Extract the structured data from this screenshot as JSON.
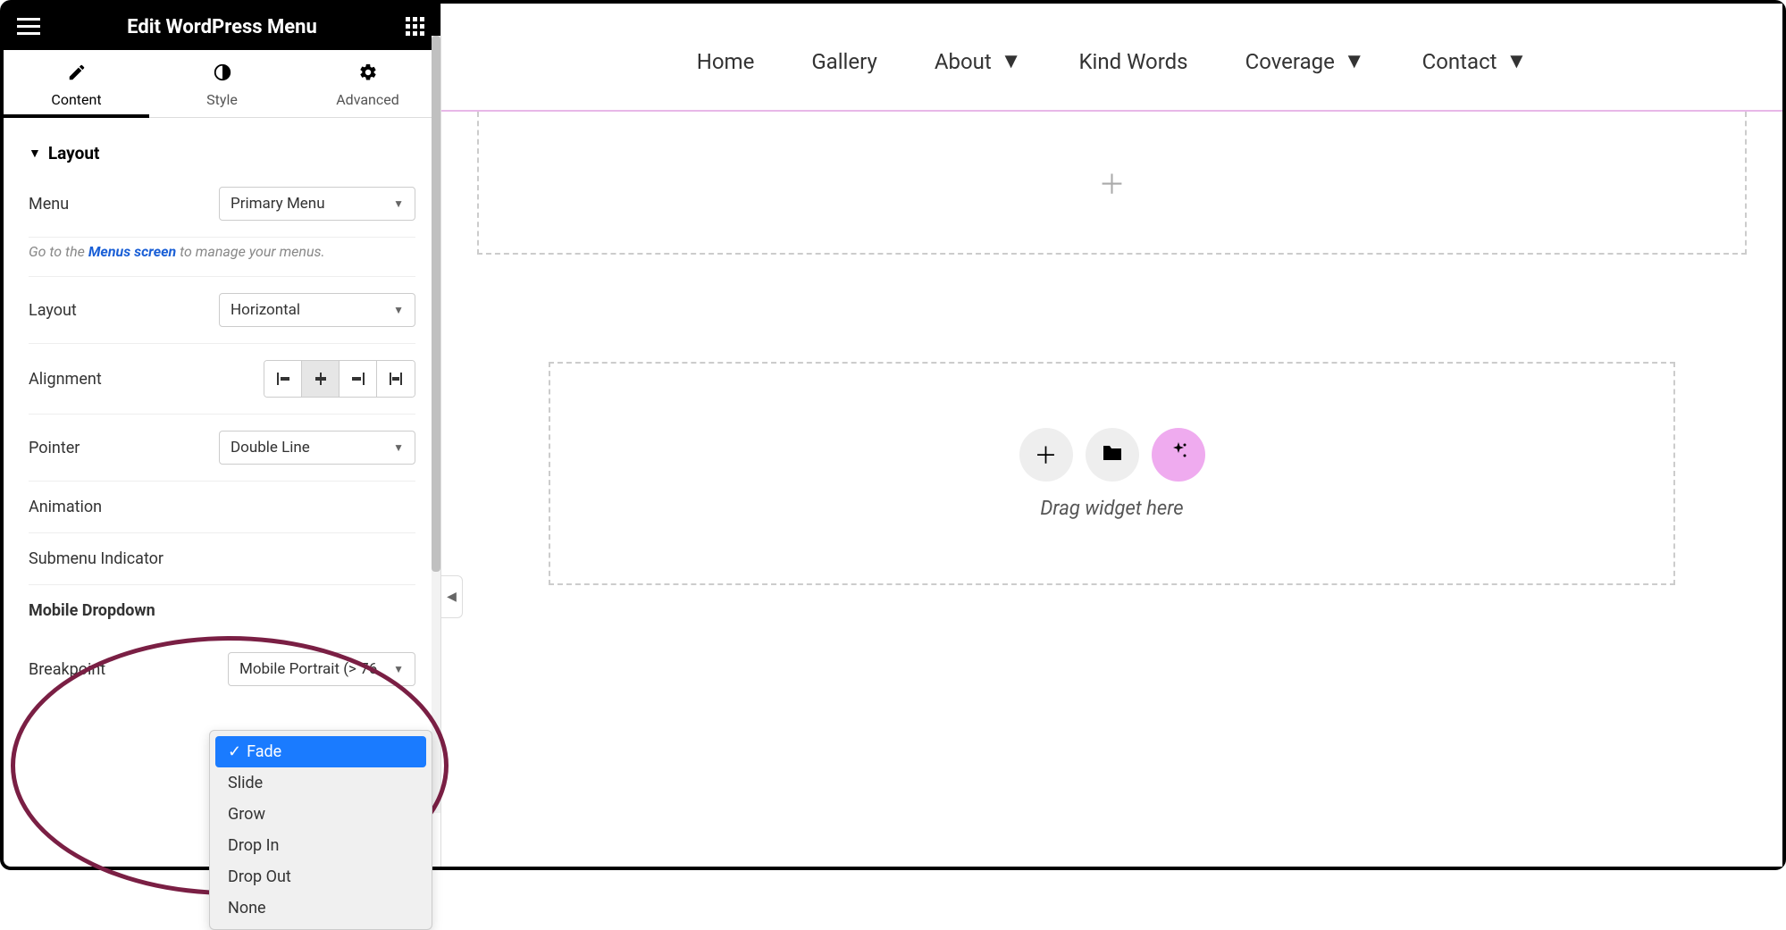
{
  "header": {
    "title": "Edit WordPress Menu"
  },
  "tabs": [
    {
      "label": "Content",
      "active": true
    },
    {
      "label": "Style",
      "active": false
    },
    {
      "label": "Advanced",
      "active": false
    }
  ],
  "section": {
    "title": "Layout"
  },
  "controls": {
    "menu": {
      "label": "Menu",
      "value": "Primary Menu"
    },
    "hint_prefix": "Go to the ",
    "hint_link": "Menus screen",
    "hint_suffix": " to manage your menus.",
    "layout": {
      "label": "Layout",
      "value": "Horizontal"
    },
    "alignment": {
      "label": "Alignment"
    },
    "pointer": {
      "label": "Pointer",
      "value": "Double Line"
    },
    "animation": {
      "label": "Animation",
      "options": [
        "Fade",
        "Slide",
        "Grow",
        "Drop In",
        "Drop Out",
        "None"
      ],
      "selected": "Fade"
    },
    "submenu": {
      "label": "Submenu Indicator"
    },
    "mobile_dd": {
      "label": "Mobile Dropdown"
    },
    "breakpoint": {
      "label": "Breakpoint",
      "value": "Mobile Portrait (> 76"
    }
  },
  "canvas": {
    "nav": [
      "Home",
      "Gallery",
      "About",
      "Kind Words",
      "Coverage",
      "Contact"
    ],
    "nav_dropdown": [
      false,
      false,
      true,
      false,
      true,
      true
    ],
    "drag_hint": "Drag widget here"
  }
}
